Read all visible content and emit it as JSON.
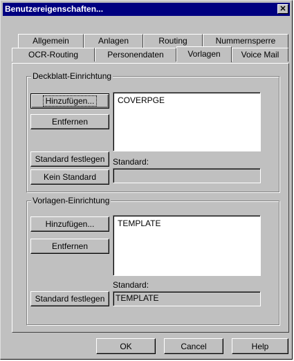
{
  "window": {
    "title": "Benutzereigenschaften...",
    "close_glyph": "✕"
  },
  "tabs": {
    "row1": [
      "Allgemein",
      "Anlagen",
      "Routing",
      "Nummernsperre"
    ],
    "row2": [
      "OCR-Routing",
      "Personendaten",
      "Vorlagen",
      "Voice Mail"
    ],
    "active": "Vorlagen"
  },
  "coverpage_group": {
    "title": "Deckblatt-Einrichtung",
    "add_label": "Hinzufügen...",
    "remove_label": "Entfernen",
    "set_default_label": "Standard festlegen",
    "no_default_label": "Kein Standard",
    "items": [
      "COVERPGE"
    ],
    "default_label": "Standard:",
    "default_value": ""
  },
  "template_group": {
    "title": "Vorlagen-Einrichtung",
    "add_label": "Hinzufügen...",
    "remove_label": "Entfernen",
    "set_default_label": "Standard festlegen",
    "items": [
      "TEMPLATE"
    ],
    "default_label": "Standard:",
    "default_value": "TEMPLATE"
  },
  "footer": {
    "ok_label": "OK",
    "cancel_label": "Cancel",
    "help_label": "Help"
  }
}
